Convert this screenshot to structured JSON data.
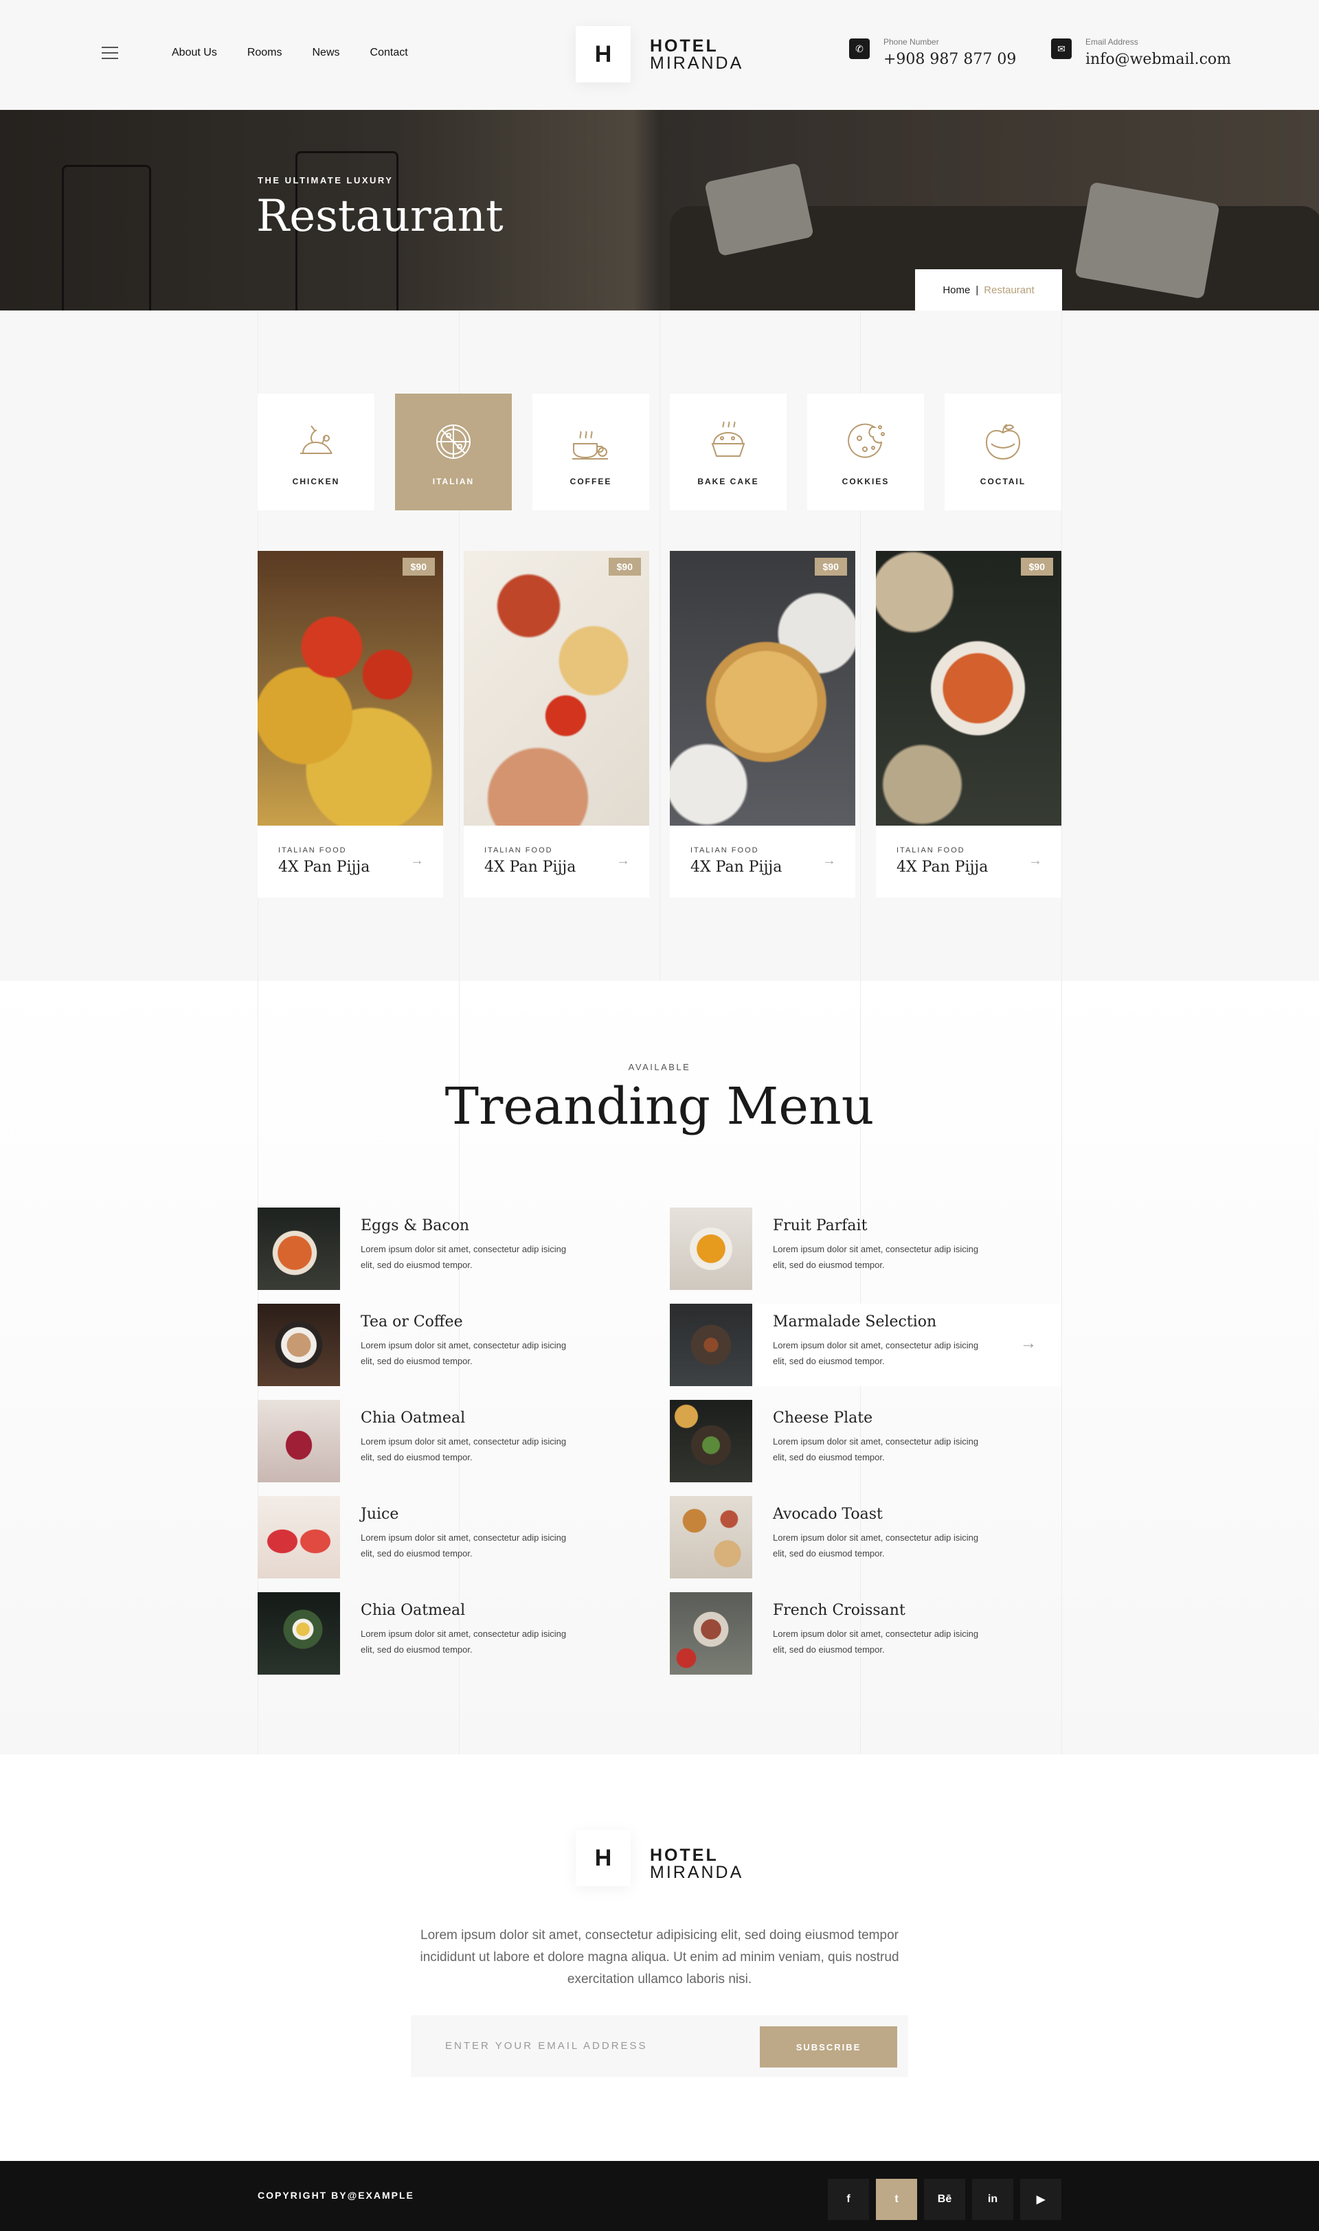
{
  "header": {
    "nav": [
      "About Us",
      "Rooms",
      "News",
      "Contact"
    ],
    "logo_letter": "H",
    "logo_line1": "HOTEL",
    "logo_line2": "MIRANDA",
    "phone_label": "Phone Number",
    "phone_value": "+908 987 877 09",
    "email_label": "Email Address",
    "email_value": "info@webmail.com"
  },
  "hero": {
    "subtitle": "THE ULTIMATE LUXURY",
    "title": "Restaurant",
    "breadcrumb_home": "Home",
    "breadcrumb_sep": "|",
    "breadcrumb_current": "Restaurant"
  },
  "categories": [
    {
      "label": "CHICKEN",
      "icon": "chicken-icon",
      "active": false
    },
    {
      "label": "ITALIAN",
      "icon": "pizza-icon",
      "active": true
    },
    {
      "label": "COFFEE",
      "icon": "coffee-icon",
      "active": false
    },
    {
      "label": "BAKE CAKE",
      "icon": "cake-icon",
      "active": false
    },
    {
      "label": "COKKIES",
      "icon": "cookie-icon",
      "active": false
    },
    {
      "label": "COCTAIL",
      "icon": "apple-icon",
      "active": false
    }
  ],
  "cards": [
    {
      "price": "$90",
      "tag": "ITALIAN FOOD",
      "name": "4X Pan Pijja"
    },
    {
      "price": "$90",
      "tag": "ITALIAN FOOD",
      "name": "4X Pan Pijja"
    },
    {
      "price": "$90",
      "tag": "ITALIAN FOOD",
      "name": "4X Pan Pijja"
    },
    {
      "price": "$90",
      "tag": "ITALIAN FOOD",
      "name": "4X Pan Pijja"
    }
  ],
  "trending": {
    "subtitle": "AVAILABLE",
    "title": "Treanding Menu",
    "description": "Lorem ipsum dolor sit amet, consectetur adip isicing elit, sed do eiusmod tempor.",
    "left": [
      "Eggs & Bacon",
      "Tea or Coffee",
      "Chia Oatmeal",
      "Juice",
      "Chia Oatmeal"
    ],
    "right": [
      "Fruit Parfait",
      "Marmalade Selection",
      "Cheese Plate",
      "Avocado Toast",
      "French Croissant"
    ]
  },
  "footer": {
    "logo_letter": "H",
    "logo_line1": "HOTEL",
    "logo_line2": "MIRANDA",
    "paragraph": "Lorem ipsum dolor sit amet, consectetur adipisicing elit, sed doing eiusmod tempor incididunt ut labore et dolore magna aliqua. Ut enim ad minim veniam, quis nostrud exercitation ullamco laboris nisi.",
    "email_placeholder": "ENTER YOUR EMAIL ADDRESS",
    "subscribe_label": "SUBSCRIBE",
    "copyright": "COPYRIGHT BY@EXAMPLE",
    "socials": [
      "f",
      "t",
      "Bē",
      "in",
      "▶"
    ]
  },
  "colors": {
    "accent": "#bda987",
    "dark": "#111111"
  }
}
